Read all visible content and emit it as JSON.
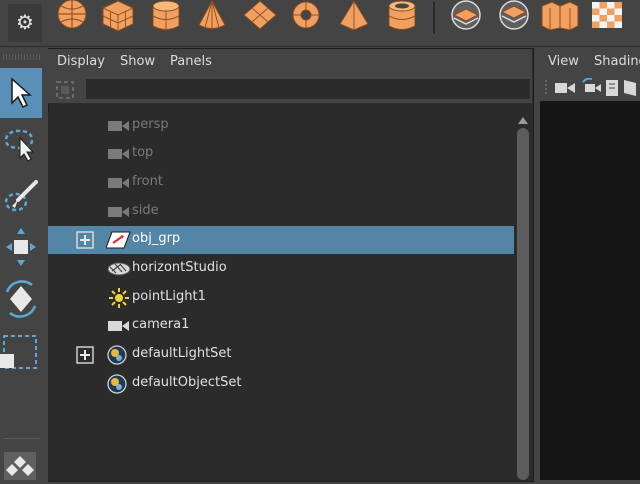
{
  "shelf": {
    "icons": [
      "sphere-icon",
      "cube-icon",
      "cylinder-icon",
      "cone-icon",
      "plane-icon",
      "torus-icon",
      "pyramid-icon",
      "pipe-icon",
      "layer-icon",
      "layer-stack-icon",
      "polygon-cubes-icon",
      "checker-grid-icon"
    ],
    "gear_glyph": "⚙"
  },
  "toolbox": {
    "tools": [
      "select-tool",
      "lasso-tool",
      "paint-select-tool",
      "move-tool",
      "rotate-tool",
      "scale-tool"
    ]
  },
  "outliner": {
    "menu": [
      "Display",
      "Show",
      "Panels"
    ],
    "search": {
      "value": "",
      "placeholder": ""
    },
    "rows": [
      {
        "label": "persp",
        "icon": "camera-icon",
        "style": "dim",
        "expandable": false,
        "selected": false
      },
      {
        "label": "top",
        "icon": "camera-icon",
        "style": "dim",
        "expandable": false,
        "selected": false
      },
      {
        "label": "front",
        "icon": "camera-icon",
        "style": "dim",
        "expandable": false,
        "selected": false
      },
      {
        "label": "side",
        "icon": "camera-icon",
        "style": "dim",
        "expandable": false,
        "selected": false
      },
      {
        "label": "obj_grp",
        "icon": "group-icon",
        "style": "bright",
        "expandable": true,
        "selected": true
      },
      {
        "label": "horizontStudio",
        "icon": "studio-icon",
        "style": "bright",
        "expandable": false,
        "selected": false
      },
      {
        "label": "pointLight1",
        "icon": "point-light-icon",
        "style": "bright",
        "expandable": false,
        "selected": false
      },
      {
        "label": "camera1",
        "icon": "camera-icon",
        "style": "bright",
        "expandable": false,
        "selected": false
      },
      {
        "label": "defaultLightSet",
        "icon": "set-icon",
        "style": "bright",
        "expandable": true,
        "selected": false
      },
      {
        "label": "defaultObjectSet",
        "icon": "set-icon",
        "style": "bright",
        "expandable": false,
        "selected": false
      }
    ]
  },
  "viewport": {
    "menu": [
      "View",
      "Shading"
    ]
  },
  "colors": {
    "accent": "#f0a060",
    "selection": "#5285a6",
    "tool_active": "#5a8fb8"
  }
}
